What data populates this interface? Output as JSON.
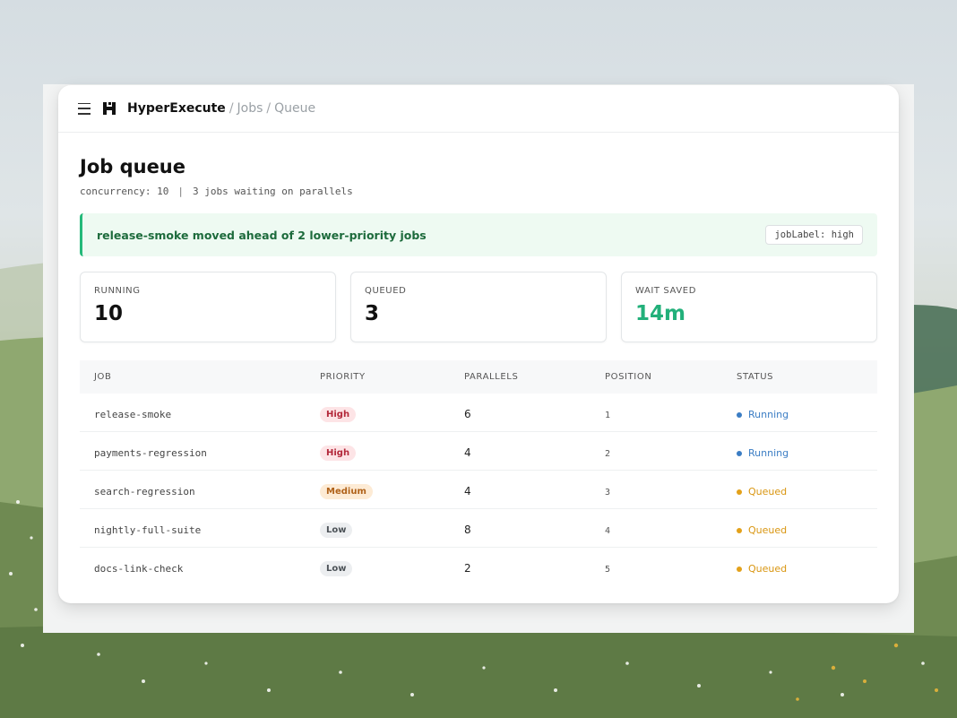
{
  "app": {
    "brand": "HyperExecute",
    "breadcrumb": [
      "Jobs",
      "Queue"
    ]
  },
  "page": {
    "title": "Job queue",
    "concurrency": "concurrency: 10",
    "waiting": "3 jobs waiting on parallels",
    "separator": "|"
  },
  "banner": {
    "message": "release-smoke moved ahead of 2 lower-priority jobs",
    "chip": "jobLabel: high"
  },
  "stats": [
    {
      "label": "RUNNING",
      "value": "10"
    },
    {
      "label": "QUEUED",
      "value": "3"
    },
    {
      "label": "WAIT SAVED",
      "value": "14m"
    }
  ],
  "table": {
    "columns": [
      "JOB",
      "PRIORITY",
      "PARALLELS",
      "POSITION",
      "STATUS"
    ],
    "rows": [
      {
        "job": "release-smoke",
        "priority": "High",
        "parallels": "6",
        "position": "1",
        "status": "Running"
      },
      {
        "job": "payments-regression",
        "priority": "High",
        "parallels": "4",
        "position": "2",
        "status": "Running"
      },
      {
        "job": "search-regression",
        "priority": "Medium",
        "parallels": "4",
        "position": "3",
        "status": "Queued"
      },
      {
        "job": "nightly-full-suite",
        "priority": "Low",
        "parallels": "8",
        "position": "4",
        "status": "Queued"
      },
      {
        "job": "docs-link-check",
        "priority": "Low",
        "parallels": "2",
        "position": "5",
        "status": "Queued"
      }
    ]
  },
  "colors": {
    "accent_green": "#22b07a",
    "running_blue": "#3b7dc4",
    "queued_amber": "#e3a11a",
    "high_badge": "#fde4e6",
    "medium_badge": "#fdebd5",
    "low_badge": "#eceef0"
  },
  "icons": {
    "menu": "hamburger-icon",
    "logo": "hyperexecute-logo"
  }
}
